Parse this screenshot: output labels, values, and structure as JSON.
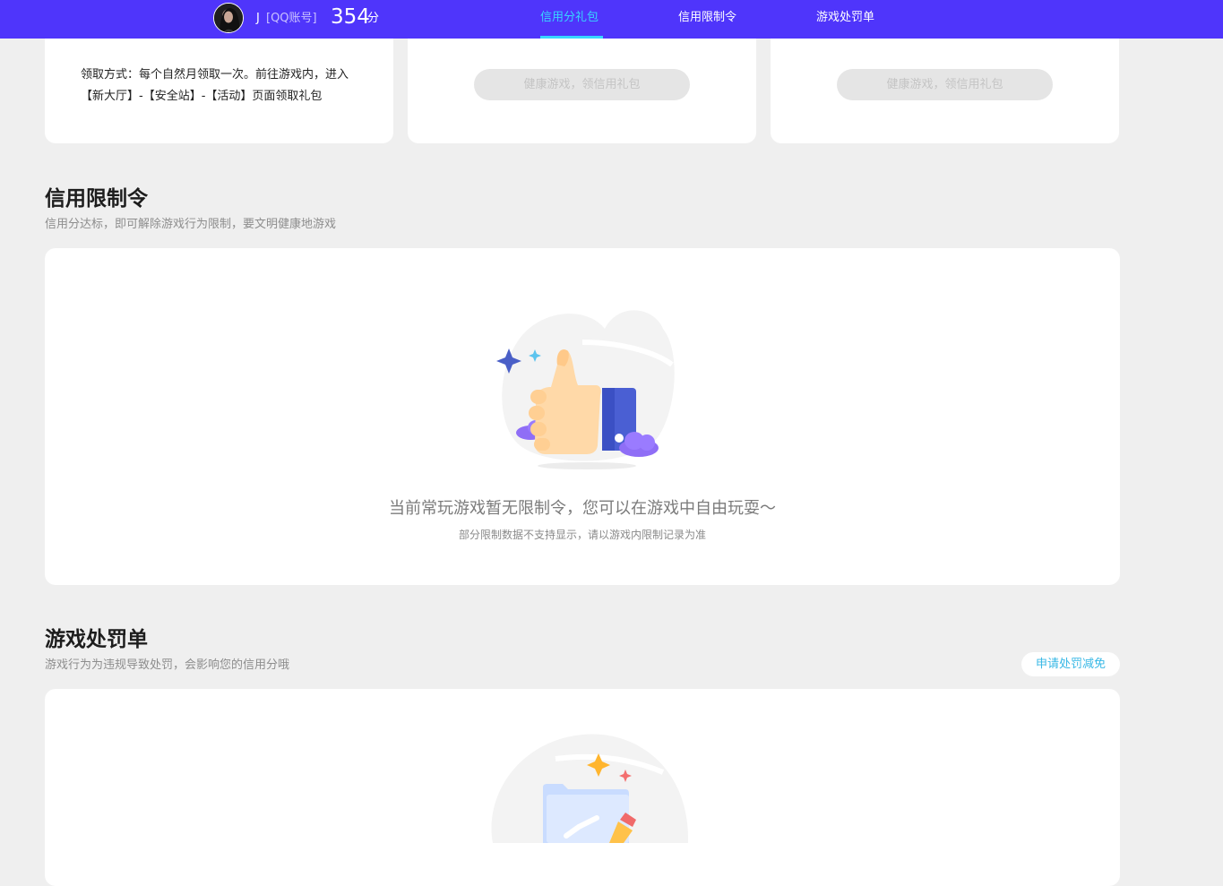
{
  "header": {
    "user_name": "J",
    "account_type": "[QQ账号]",
    "score_value": "354",
    "score_unit": "分",
    "tabs": [
      {
        "label": "信用分礼包",
        "active": true
      },
      {
        "label": "信用限制令",
        "active": false
      },
      {
        "label": "游戏处罚单",
        "active": false
      }
    ],
    "bar_color": "#4f35fb",
    "active_color": "#37d6ff"
  },
  "gift_packs": {
    "claim_method": "领取方式：每个自然月领取一次。前往游戏内，进入【新大厅】-【安全站】-【活动】页面领取礼包",
    "card2_button": "健康游戏，领信用礼包",
    "card3_button": "健康游戏，领信用礼包"
  },
  "restrictions": {
    "title": "信用限制令",
    "subtitle": "信用分达标，即可解除游戏行为限制，要文明健康地游戏",
    "empty_main": "当前常玩游戏暂无限制令，您可以在游戏中自由玩耍～",
    "empty_sub": "部分限制数据不支持显示，请以游戏内限制记录为准",
    "illustration_icon": "thumbs-up-icon"
  },
  "penalties": {
    "title": "游戏处罚单",
    "subtitle": "游戏行为为违规导致处罚，会影响您的信用分哦",
    "apply_button": "申请处罚减免",
    "illustration_icon": "folder-check-icon"
  }
}
